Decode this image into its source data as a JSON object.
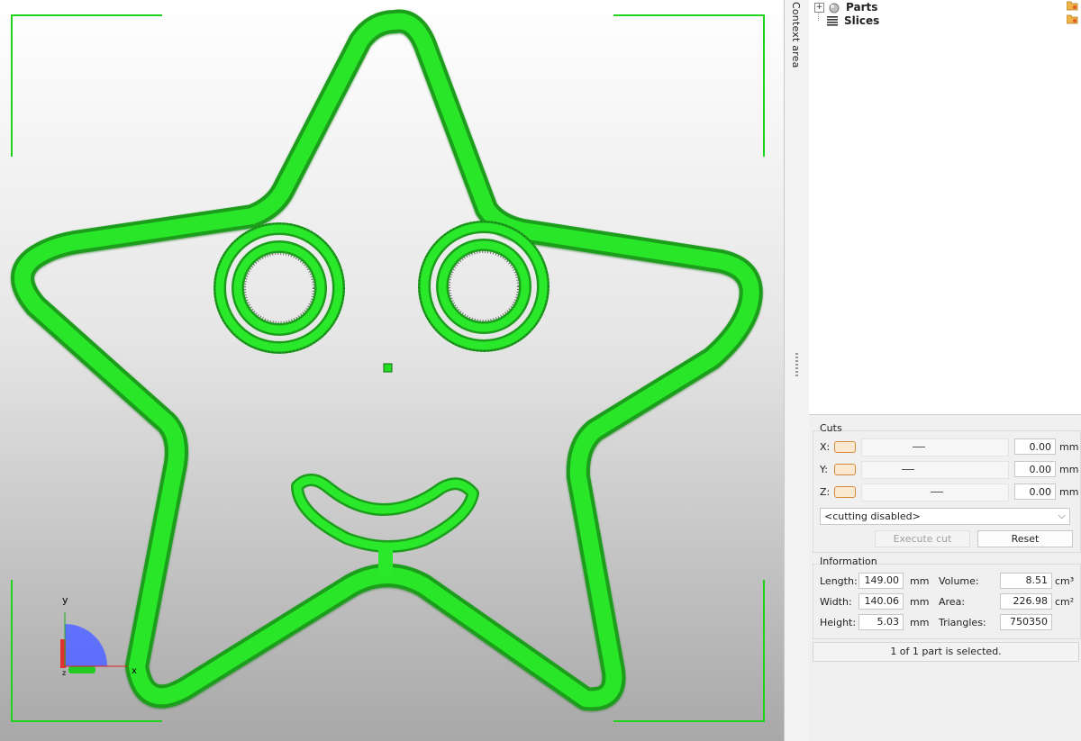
{
  "viewport": {
    "axis_labels": {
      "x": "x",
      "y": "y",
      "z": "z"
    }
  },
  "context_area": {
    "label": "Context area"
  },
  "tree": {
    "items": [
      {
        "label": "Parts",
        "icon": "parts-icon"
      },
      {
        "label": "Slices",
        "icon": "slices-icon"
      }
    ]
  },
  "cuts": {
    "title": "Cuts",
    "rows": [
      {
        "axis": "X:",
        "value": "0.00",
        "unit": "mm"
      },
      {
        "axis": "Y:",
        "value": "0.00",
        "unit": "mm"
      },
      {
        "axis": "Z:",
        "value": "0.00",
        "unit": "mm"
      }
    ],
    "mode_select": "<cutting disabled>",
    "execute_label": "Execute cut",
    "reset_label": "Reset"
  },
  "information": {
    "title": "Information",
    "length_label": "Length:",
    "length_value": "149.00",
    "length_unit": "mm",
    "width_label": "Width:",
    "width_value": "140.06",
    "width_unit": "mm",
    "height_label": "Height:",
    "height_value": "5.03",
    "height_unit": "mm",
    "volume_label": "Volume:",
    "volume_value": "8.51",
    "volume_unit": "cm³",
    "area_label": "Area:",
    "area_value": "226.98",
    "area_unit": "cm²",
    "triangles_label": "Triangles:",
    "triangles_value": "750350"
  },
  "status": {
    "text": "1 of 1 part is selected."
  },
  "colors": {
    "model": "#22dd22",
    "selection": "#1ed21e",
    "accent": "#d48a3a"
  }
}
